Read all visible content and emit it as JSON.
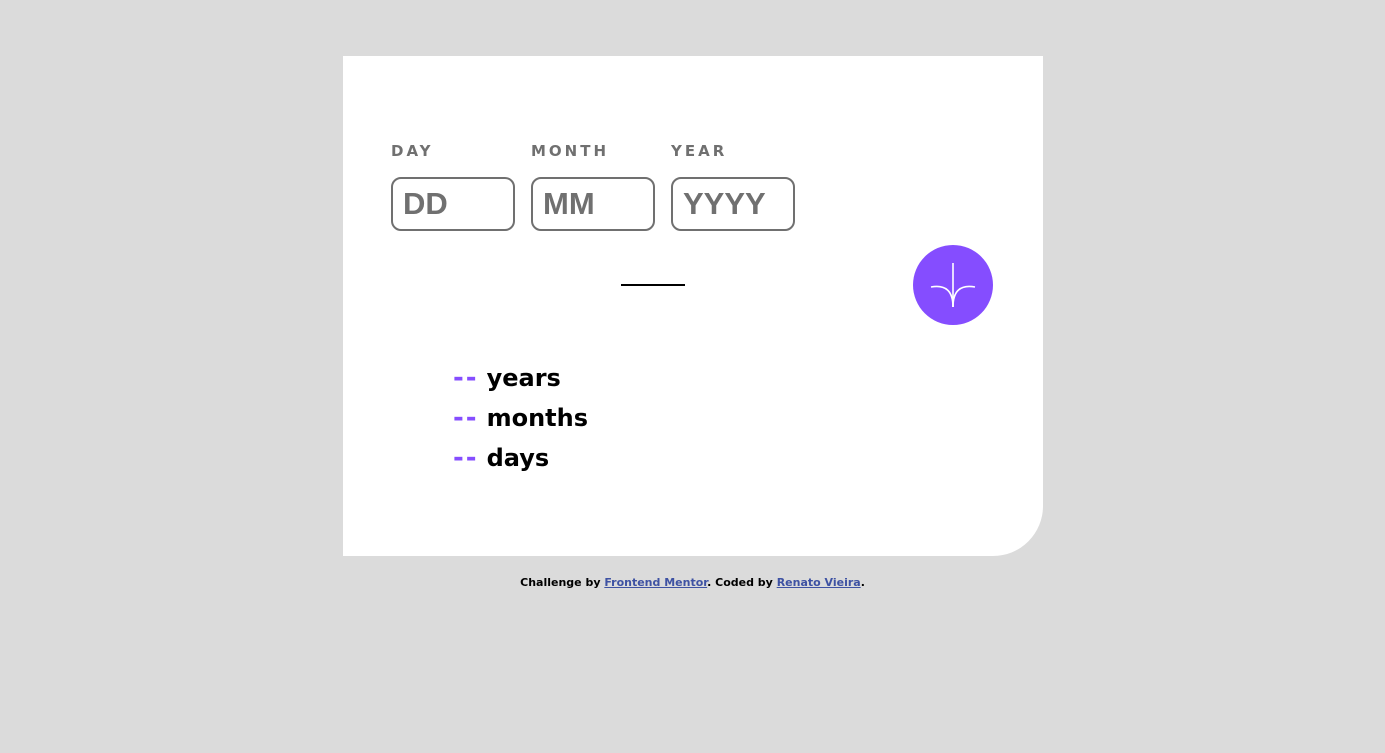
{
  "form": {
    "day": {
      "label": "DAY",
      "placeholder": "DD",
      "value": ""
    },
    "month": {
      "label": "MONTH",
      "placeholder": "MM",
      "value": ""
    },
    "year": {
      "label": "YEAR",
      "placeholder": "YYYY",
      "value": ""
    }
  },
  "submit": {
    "icon": "arrow-down-icon"
  },
  "results": [
    {
      "value": "--",
      "unit": "years"
    },
    {
      "value": "--",
      "unit": "months"
    },
    {
      "value": "--",
      "unit": "days"
    }
  ],
  "footer": {
    "prefix": "Challenge by ",
    "link1": "Frontend Mentor",
    "middle": ". Coded by ",
    "link2": "Renato Vieira",
    "suffix": "."
  },
  "colors": {
    "background": "#dbdbdb",
    "card": "#ffffff",
    "accent": "#854dff",
    "label": "#707070",
    "link": "#3e52a3"
  }
}
